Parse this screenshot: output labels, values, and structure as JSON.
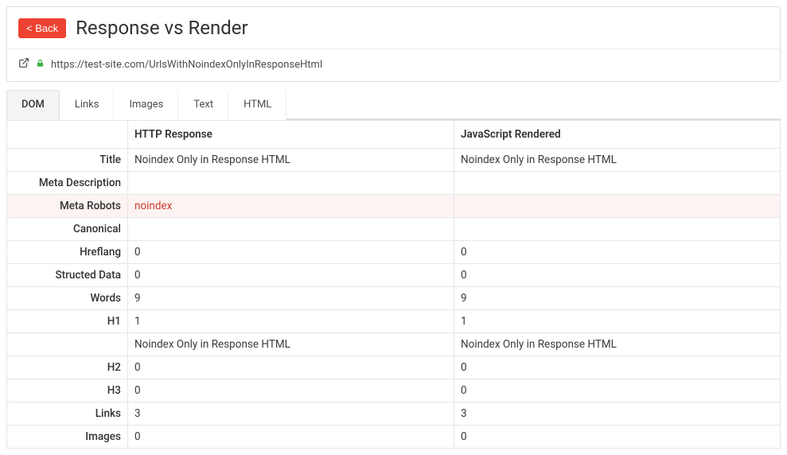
{
  "header": {
    "back_label": "< Back",
    "title": "Response vs Render"
  },
  "url": "https://test-site.com/UrlsWithNoindexOnlyInResponseHtml",
  "tabs": {
    "dom": "DOM",
    "links": "Links",
    "images": "Images",
    "text": "Text",
    "html": "HTML"
  },
  "table": {
    "col_response": "HTTP Response",
    "col_rendered": "JavaScript Rendered",
    "rows": {
      "title_label": "Title",
      "title_resp": "Noindex Only in Response HTML",
      "title_rend": "Noindex Only in Response HTML",
      "meta_desc_label": "Meta Description",
      "meta_desc_resp": "",
      "meta_desc_rend": "",
      "meta_robots_label": "Meta Robots",
      "meta_robots_resp": "noindex",
      "meta_robots_rend": "",
      "canonical_label": "Canonical",
      "canonical_resp": "",
      "canonical_rend": "",
      "hreflang_label": "Hreflang",
      "hreflang_resp": "0",
      "hreflang_rend": "0",
      "structed_label": "Structed Data",
      "structed_resp": "0",
      "structed_rend": "0",
      "words_label": "Words",
      "words_resp": "9",
      "words_rend": "9",
      "h1_label": "H1",
      "h1_resp": "1",
      "h1_rend": "1",
      "h1text_label": "",
      "h1text_resp": "Noindex Only in Response HTML",
      "h1text_rend": "Noindex Only in Response HTML",
      "h2_label": "H2",
      "h2_resp": "0",
      "h2_rend": "0",
      "h3_label": "H3",
      "h3_resp": "0",
      "h3_rend": "0",
      "links_label": "Links",
      "links_resp": "3",
      "links_rend": "3",
      "images_label": "Images",
      "images_resp": "0",
      "images_rend": "0"
    }
  }
}
